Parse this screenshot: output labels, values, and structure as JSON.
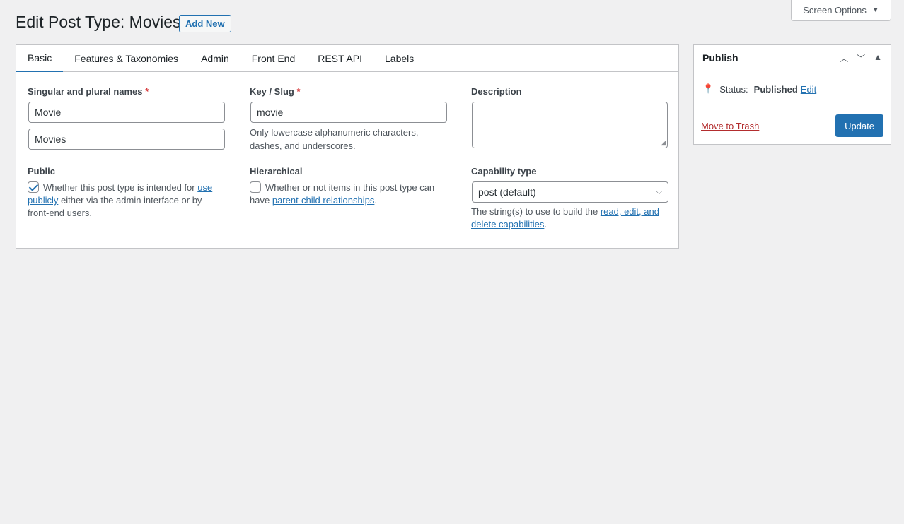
{
  "header": {
    "screen_options": "Screen Options",
    "title": "Edit Post Type: Movies",
    "add_new": "Add New"
  },
  "tabs": [
    "Basic",
    "Features & Taxonomies",
    "Admin",
    "Front End",
    "REST API",
    "Labels"
  ],
  "fields": {
    "names_label": "Singular and plural names",
    "singular_value": "Movie",
    "plural_value": "Movies",
    "slug_label": "Key / Slug",
    "slug_value": "movie",
    "slug_help": "Only lowercase alphanumeric characters, dashes, and underscores.",
    "description_label": "Description",
    "public_label": "Public",
    "public_help_1": "Whether this post type is intended for",
    "public_link": "use publicly",
    "public_help_2": "either via the admin interface or by front-end users.",
    "hier_label": "Hierarchical",
    "hier_help_1": "Whether or not items in this post type can have",
    "hier_link": "parent-child relationships",
    "hier_help_2": ".",
    "cap_label": "Capability type",
    "cap_value": "post (default)",
    "cap_help_1": "The string(s) to use to build the",
    "cap_link": "read, edit, and delete capabilities",
    "cap_help_2": "."
  },
  "publish": {
    "title": "Publish",
    "status_label": "Status:",
    "status_value": "Published",
    "status_edit": "Edit",
    "trash": "Move to Trash",
    "update": "Update"
  },
  "required_mark": "*"
}
